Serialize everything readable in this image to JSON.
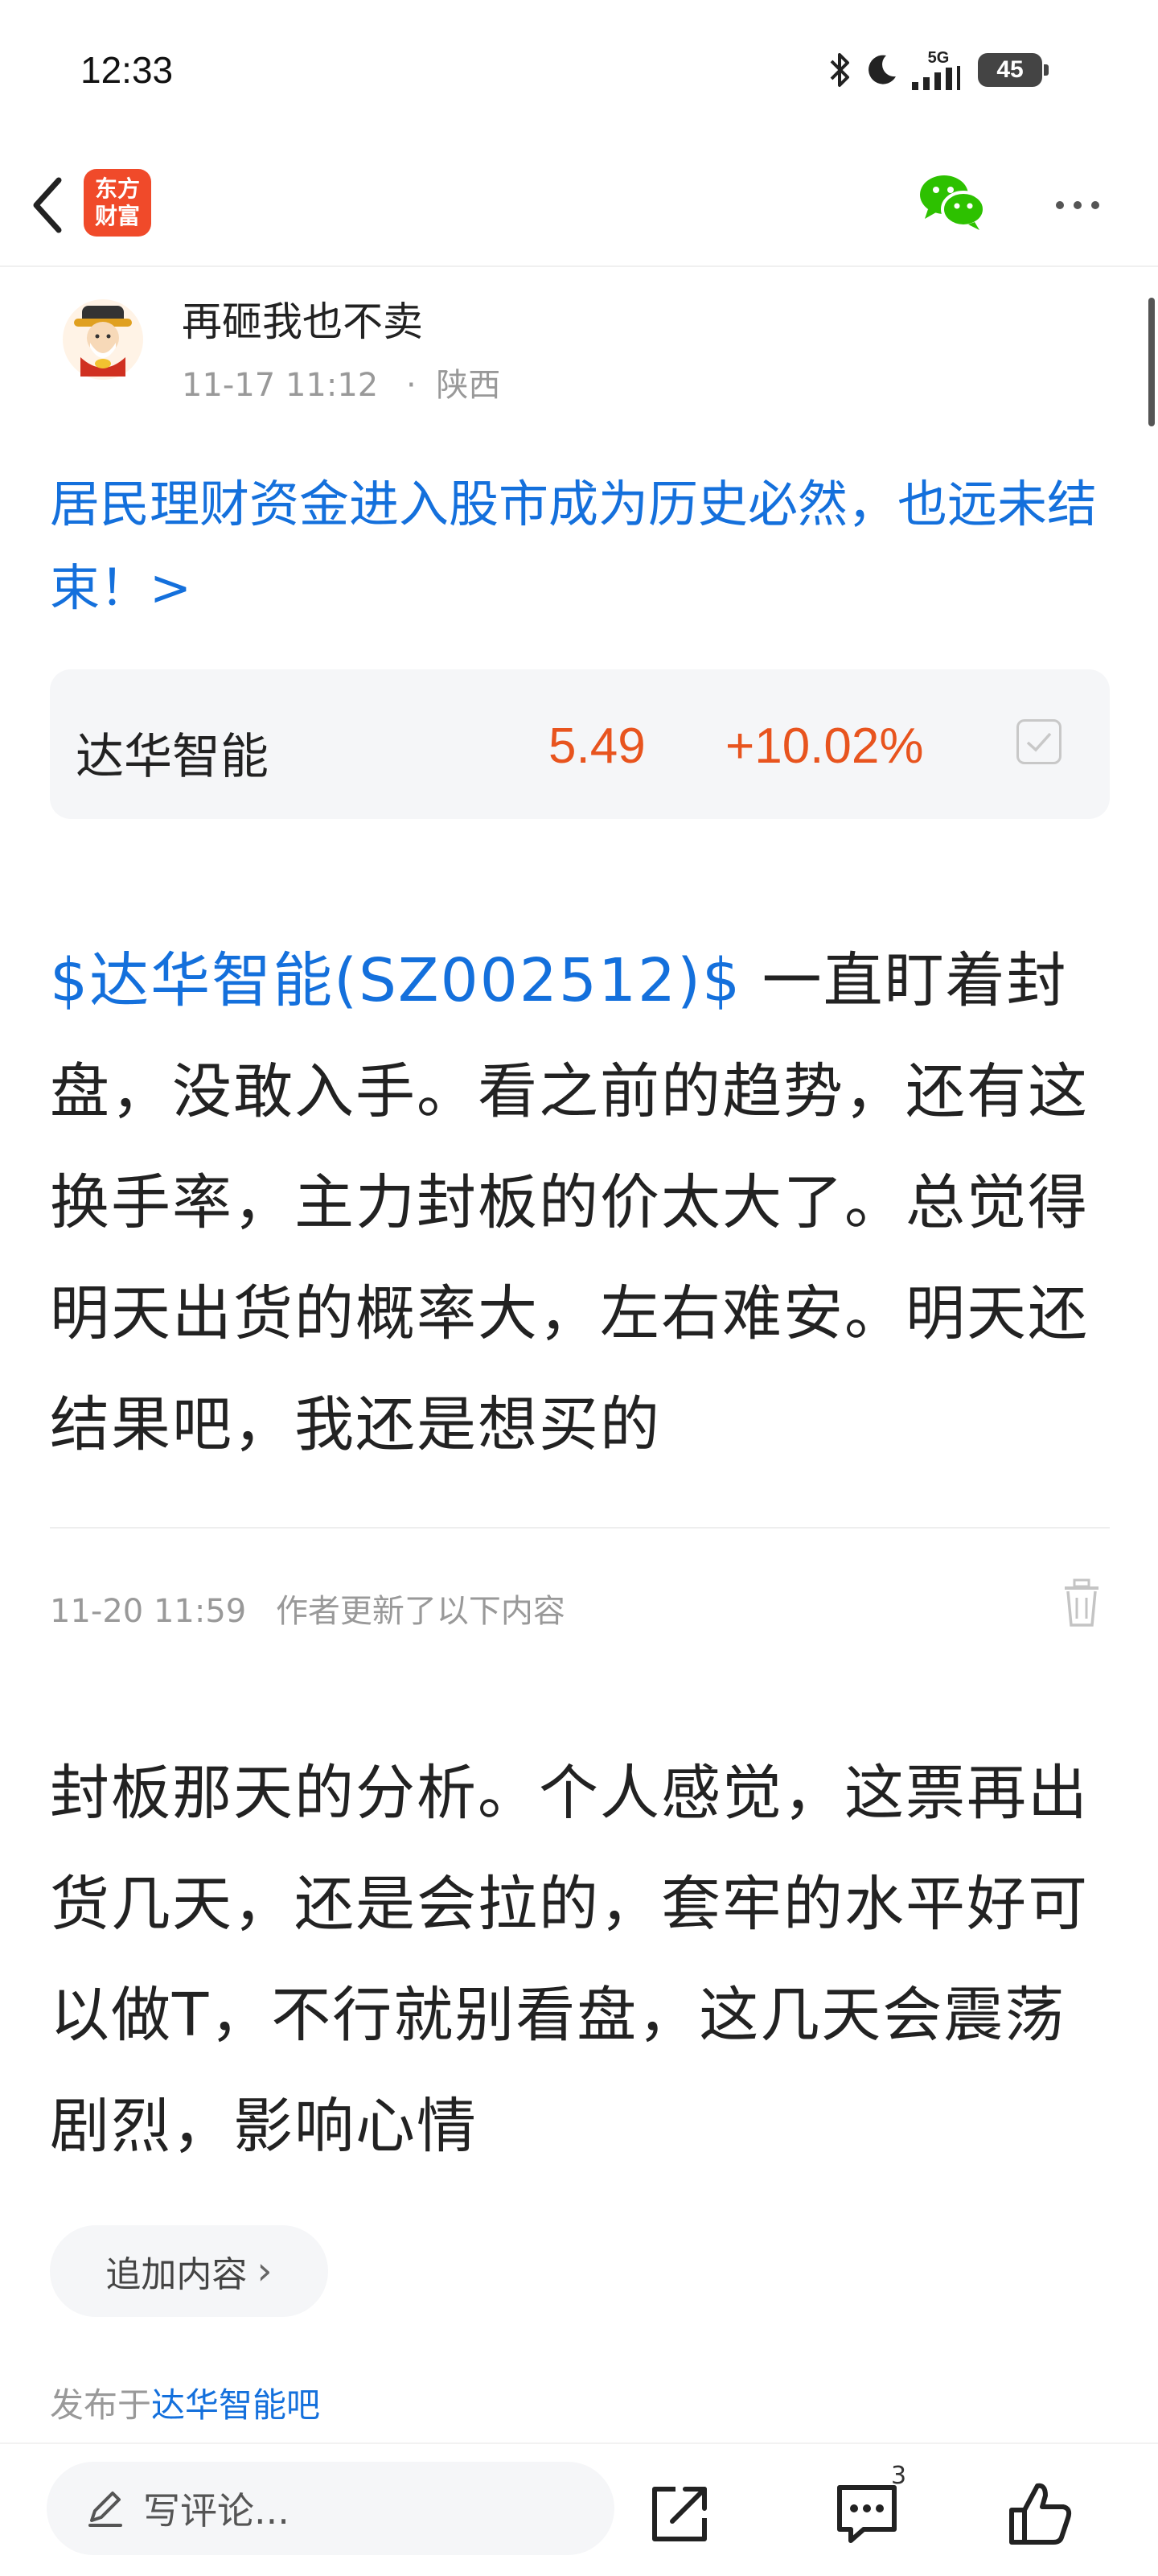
{
  "status_bar": {
    "time": "12:33",
    "battery": "45",
    "network": "5G"
  },
  "nav": {
    "logo_line1": "东方",
    "logo_line2": "财富"
  },
  "author": {
    "name": "再砸我也不卖",
    "date": "11-17 11:12",
    "separator": "·",
    "location": "陕西"
  },
  "post": {
    "title": "居民理财资金进入股市成为历史必然，也远未结束！>"
  },
  "stock": {
    "name": "达华智能",
    "price": "5.49",
    "change": "+10.02%"
  },
  "content": {
    "tag": "$达华智能(SZ002512)$",
    "body": " 一直盯着封盘，没敢入手。看之前的趋势，还有这换手率，主力封板的价太大了。总觉得明天出货的概率大，左右难安。明天还结果吧，我还是想买的"
  },
  "update": {
    "time": "11-20 11:59",
    "label": "作者更新了以下内容"
  },
  "content2": {
    "body": "封板那天的分析。个人感觉，这票再出货几天，还是会拉的，套牢的水平好可以做T，不行就别看盘，这几天会震荡剧烈，影响心情"
  },
  "add_content": {
    "label": "追加内容",
    "chevron": "›"
  },
  "publish": {
    "prefix": "发布于",
    "forum": "达华智能吧"
  },
  "bottom": {
    "comment_placeholder": "写评论...",
    "comment_count": "3"
  },
  "colors": {
    "link": "#1470dc",
    "up": "#e8541e",
    "logo": "#f04a2a"
  }
}
